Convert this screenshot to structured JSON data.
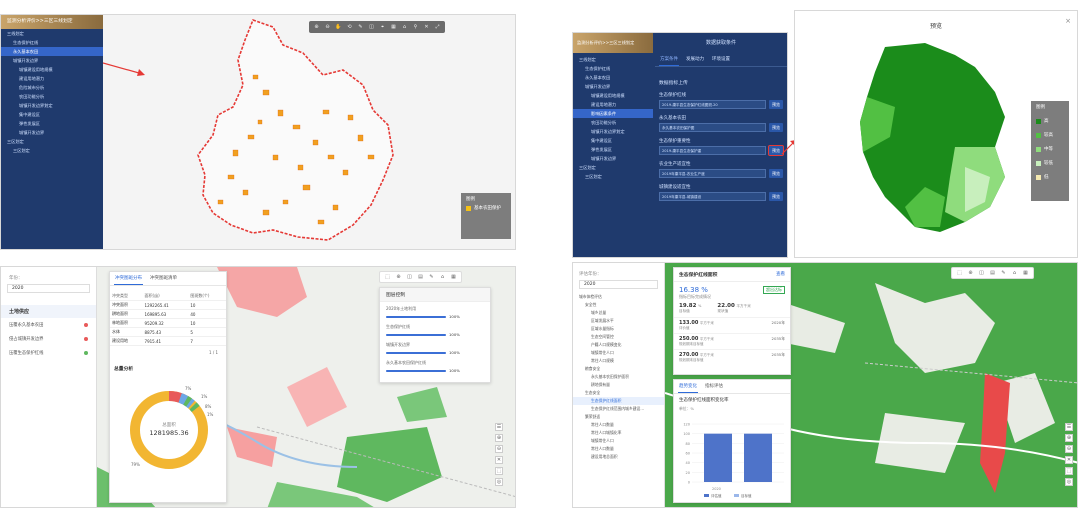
{
  "colors": {
    "navy": "#1f3a6d",
    "accent": "#3566c9",
    "gold": "#b58f55",
    "red": "#e53935",
    "green_dark": "#18a218",
    "green_light": "#c8f0c0"
  },
  "p1": {
    "title": "监测分析评价>>三区三线划定",
    "tree": [
      {
        "label": "三线划定",
        "level": 0
      },
      {
        "label": "生态保护红线",
        "level": 1
      },
      {
        "label": "永久基本农田",
        "level": 1,
        "active": true
      },
      {
        "label": "城镇开发边界",
        "level": 1
      },
      {
        "label": "城镇建设用地规模",
        "level": 2
      },
      {
        "label": "建设用地潜力",
        "level": 2
      },
      {
        "label": "危险城市分析",
        "level": 2
      },
      {
        "label": "农田功能分析",
        "level": 2
      },
      {
        "label": "城镇开发边界划定",
        "level": 2
      },
      {
        "label": "集中建设区",
        "level": 2
      },
      {
        "label": "弹性发展区",
        "level": 2
      },
      {
        "label": "城镇开发边界",
        "level": 2
      },
      {
        "label": "三区划定",
        "level": 0
      },
      {
        "label": "三区划定",
        "level": 1
      }
    ],
    "legend_title": "图例",
    "legend_item": "基本农田保护"
  },
  "p2": {
    "title": "监测分析评价>>三区三线划定",
    "top_title": "数据获取条件",
    "tabs": [
      "方案条件",
      "发展动力",
      "环境设置"
    ],
    "tree": [
      {
        "label": "三线划定",
        "level": 0
      },
      {
        "label": "生态保护红线",
        "level": 1
      },
      {
        "label": "永久基本农田",
        "level": 1
      },
      {
        "label": "城镇开发边界",
        "level": 1
      },
      {
        "label": "城镇建设用地规模",
        "level": 2
      },
      {
        "label": "建设用地潜力",
        "level": 2
      },
      {
        "label": "影响因素条件",
        "level": 2,
        "active": true
      },
      {
        "label": "农田功能分析",
        "level": 2
      },
      {
        "label": "城镇开发边界划定",
        "level": 2
      },
      {
        "label": "集中建设区",
        "level": 2
      },
      {
        "label": "弹性发展区",
        "level": 2
      },
      {
        "label": "城镇开发边界",
        "level": 2
      },
      {
        "label": "三区划定",
        "level": 0
      },
      {
        "label": "三区划定",
        "level": 1
      }
    ],
    "form_title": "数据指标上传",
    "fields": [
      {
        "label": "生态保护红线",
        "value": "2019-康平县生态保护红线图斑.20"
      },
      {
        "label": "永久基本农田",
        "value": "永久基本农田保护图"
      },
      {
        "label": "生态保护重要性",
        "value": "2019-康平县生态保护重"
      },
      {
        "label": "农业生产适宜性",
        "value": "2019年康平县-农业生产度"
      },
      {
        "label": "城镇建设适宜性",
        "value": "2019年康平县-城镇建设"
      }
    ],
    "preview_label": "预览"
  },
  "p3": {
    "title": "预览",
    "legend_title": "图例",
    "legend": [
      {
        "label": "高",
        "color": "#1b8c1b"
      },
      {
        "label": "较高",
        "color": "#52c043"
      },
      {
        "label": "中等",
        "color": "#8fdc7d"
      },
      {
        "label": "较低",
        "color": "#c8efbd"
      },
      {
        "label": "低",
        "color": "#f4e9b0"
      }
    ],
    "close": "×"
  },
  "p4": {
    "year_label": "年份：",
    "year": "2020",
    "section": "土地供应",
    "items": [
      "压覆永久基本农田",
      "侵占城镇开发边界",
      "压覆生态保护红线"
    ],
    "tabs": [
      "冲突图斑分布",
      "冲突图斑清单"
    ],
    "table_head": [
      "冲突类型",
      "面积(亩)",
      "图斑数(个)"
    ],
    "table_rows": [
      [
        "冲突面积",
        "1292265.41",
        "10"
      ],
      [
        "耕地面积",
        "169895.63",
        "40"
      ],
      [
        "林地面积",
        "95209.32",
        "10"
      ],
      [
        "水体",
        "8875.43",
        "5"
      ],
      [
        "建设用地",
        "7915.41",
        "7"
      ]
    ],
    "pager": "1 / 1",
    "chart_title": "总量分析",
    "donut_label": "总面积",
    "donut_value": "1281985.36",
    "pct_labels": [
      "7%",
      "1%",
      "8%",
      "1%",
      "79%"
    ],
    "layer_title": "图层控制",
    "layers": [
      {
        "label": "2020年土地利用",
        "value": "100%",
        "level": 1.0
      },
      {
        "label": "生态保护红线",
        "value": "100%",
        "level": 1.0
      },
      {
        "label": "城镇开发边界",
        "value": "100%",
        "level": 1.0
      },
      {
        "label": "永久基本农田保护红线",
        "value": "100%",
        "level": 1.0
      }
    ]
  },
  "p5": {
    "year_label": "评估年份：",
    "year": "2020",
    "tree": [
      {
        "label": "城市体检评估",
        "level": 0
      },
      {
        "label": "安全性",
        "level": 1
      },
      {
        "label": "城乡总量",
        "level": 2
      },
      {
        "label": "区域发展水平",
        "level": 2
      },
      {
        "label": "区域水量指标",
        "level": 2
      },
      {
        "label": "生态空间管控",
        "level": 2
      },
      {
        "label": "户籍人口规模变化",
        "level": 2
      },
      {
        "label": "城镇常住人口",
        "level": 2
      },
      {
        "label": "常住人口规模",
        "level": 2
      },
      {
        "label": "粮食安全",
        "level": 1
      },
      {
        "label": "永久基本农田保护面积",
        "level": 2
      },
      {
        "label": "耕地保有量",
        "level": 2
      },
      {
        "label": "生态安全",
        "level": 1
      },
      {
        "label": "生态保护红线面积",
        "level": 2,
        "active": true
      },
      {
        "label": "生态保护红线范围内城乡建设...",
        "level": 2
      },
      {
        "label": "繁荣舒适",
        "level": 1
      },
      {
        "label": "常住人口数量",
        "level": 2
      },
      {
        "label": "常住人口城镇化率",
        "level": 2
      },
      {
        "label": "城镇常住人口",
        "level": 2
      },
      {
        "label": "常住人口数量",
        "level": 2
      },
      {
        "label": "建设用地总面积",
        "level": 2
      }
    ],
    "card_title": "生态保护红线面积",
    "card_action": "查看",
    "headline": "16.38 %",
    "headline_sub": "指标目标完成情况",
    "badge": "超出达标",
    "metrics": [
      {
        "v": "19.82",
        "u": "%",
        "l": "目标值"
      },
      {
        "v": "22.00",
        "u": "平方千米",
        "l": "现状值"
      }
    ],
    "rows": [
      {
        "v": "133.00",
        "u": "平方千米",
        "l": "评价值",
        "y": "2020年"
      },
      {
        "v": "250.00",
        "u": "平方千米",
        "l": "规划期末目标值",
        "y": "2035年"
      },
      {
        "v": "270.00",
        "u": "平方千米",
        "l": "规划期末目标值",
        "y": "2035年"
      }
    ],
    "chart_tabs": [
      "趋势变化",
      "指标评估"
    ],
    "chart_title": "生态保护红线面积变化率",
    "chart_unit": "单位：%",
    "legend": [
      "评估值",
      "目标值"
    ]
  },
  "chart_data": {
    "type": "bar",
    "title": "生态保护红线面积变化率",
    "ylabel": "单位：%",
    "categories": [
      "2020"
    ],
    "series": [
      {
        "name": "评估值",
        "values": [
          100
        ]
      },
      {
        "name": "目标值",
        "values": [
          100
        ]
      }
    ],
    "yticks": [
      "0",
      "20",
      "40",
      "60",
      "80",
      "100",
      "120"
    ],
    "ylim": [
      0,
      120
    ]
  },
  "tools": {
    "p1_toolbar": [
      "⊕",
      "⊖",
      "✋",
      "⟲",
      "✎",
      "◫",
      "⌖",
      "▦",
      "⌂",
      "⚲",
      "✕",
      "⤢"
    ],
    "p4_toolbar": [
      "⬚",
      "⊕",
      "◫",
      "▤",
      "✎",
      "⌂",
      "▦"
    ],
    "p5_toolbar": [
      "⬚",
      "⊕",
      "◫",
      "▤",
      "✎",
      "⌂",
      "▦"
    ],
    "side": [
      "☰",
      "⊕",
      "⊖",
      "✕",
      "⬚",
      "◎"
    ]
  }
}
